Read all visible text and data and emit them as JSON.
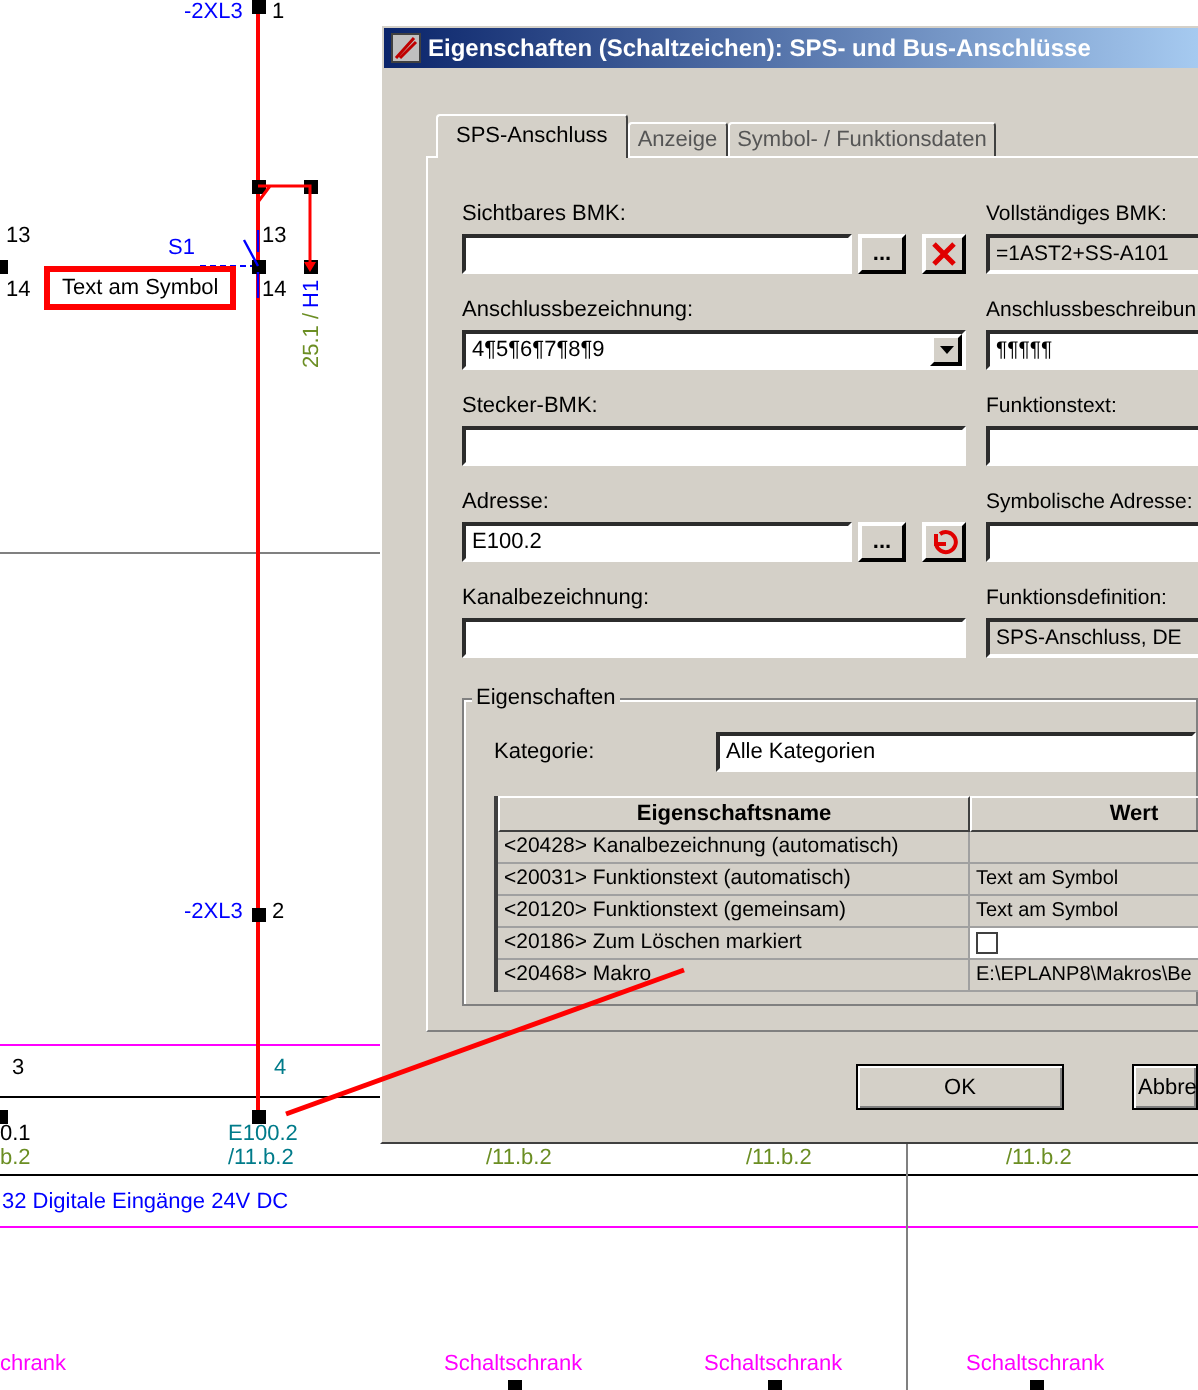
{
  "canvas": {
    "texts": [
      {
        "text": "-2XL3",
        "kind": "device"
      },
      {
        "text": "1",
        "kind": "pin"
      },
      {
        "text": "13",
        "kind": "pin"
      },
      {
        "text": "14",
        "kind": "pin"
      },
      {
        "text": "13",
        "kind": "pin"
      },
      {
        "text": "14",
        "kind": "pin"
      },
      {
        "text": "S1",
        "kind": "device"
      },
      {
        "text": "H1",
        "kind": "device_vertical"
      },
      {
        "text": "25.1 /",
        "kind": "reference_vertical"
      },
      {
        "text": "-2XL3",
        "kind": "device"
      },
      {
        "text": "2",
        "kind": "pin"
      },
      {
        "text": "3",
        "kind": "pin"
      },
      {
        "text": "4",
        "kind": "address"
      },
      {
        "text": "0.1",
        "kind": "pin"
      },
      {
        "text": "E100.2",
        "kind": "address"
      },
      {
        "text": "b.2",
        "kind": "reference"
      },
      {
        "text": "/11.b.2",
        "kind": "address"
      },
      {
        "text": "/11.b.2",
        "kind": "reference"
      },
      {
        "text": "/11.b.2",
        "kind": "reference"
      },
      {
        "text": "/11.b.2",
        "kind": "reference"
      },
      {
        "text": "32 Digitale Eingänge 24V DC",
        "kind": "device"
      },
      {
        "text": "chrank",
        "kind": "location"
      },
      {
        "text": "Schaltschrank",
        "kind": "location"
      },
      {
        "text": "Schaltschrank",
        "kind": "location"
      },
      {
        "text": "Schaltschrank",
        "kind": "location"
      }
    ],
    "callout": {
      "text": "Text am Symbol"
    }
  },
  "dialog": {
    "title": "Eigenschaften (Schaltzeichen): SPS- und Bus-Anschlüsse",
    "tabs": [
      {
        "label": "SPS-Anschluss",
        "selected": true
      },
      {
        "label": "Anzeige",
        "selected": false
      },
      {
        "label": "Symbol- / Funktionsdaten",
        "selected": false
      }
    ],
    "left_fields": [
      {
        "label": "Sichtbares BMK:",
        "kind": "browse_delete",
        "button_label": "..."
      },
      {
        "label": "Anschlussbezeichnung:",
        "kind": "combo",
        "value": "4¶5¶6¶7¶8¶9"
      },
      {
        "label": "Stecker-BMK:",
        "kind": "text"
      },
      {
        "label": "Adresse:",
        "kind": "browse_reset",
        "value": "E100.2",
        "button_label": "..."
      },
      {
        "label": "Kanalbezeichnung:",
        "kind": "text"
      }
    ],
    "right_fields": [
      {
        "label": "Vollständiges BMK:",
        "value": "=1AST2+SS-A101",
        "disabled": true
      },
      {
        "label": "Anschlussbeschreibun",
        "value": "¶¶¶¶¶",
        "disabled": false
      },
      {
        "label": "Funktionstext:",
        "disabled": false
      },
      {
        "label": "Symbolische Adresse:",
        "disabled": false
      },
      {
        "label": "Funktionsdefinition:",
        "value": "SPS-Anschluss, DE",
        "disabled": true
      }
    ],
    "group": {
      "title": "Eigenschaften",
      "category_label": "Kategorie:",
      "category_value": "Alle Kategorien",
      "table": {
        "columns": [
          "Eigenschaftsname",
          "Wert"
        ],
        "rows": [
          {
            "name": "<20428> Kanalbezeichnung (automatisch)",
            "kind": "text"
          },
          {
            "name": "<20031> Funktionstext (automatisch)",
            "kind": "text",
            "value": "Text am Symbol"
          },
          {
            "name": "<20120> Funktionstext (gemeinsam)",
            "kind": "text",
            "value": "Text am Symbol"
          },
          {
            "name": "<20186> Zum Löschen markiert",
            "kind": "checkbox",
            "checked": false
          },
          {
            "name": "<20468> Makro",
            "kind": "text",
            "value": "E:\\EPLANP8\\Makros\\Be"
          }
        ]
      }
    },
    "buttons": [
      "OK",
      "Abbre"
    ]
  }
}
